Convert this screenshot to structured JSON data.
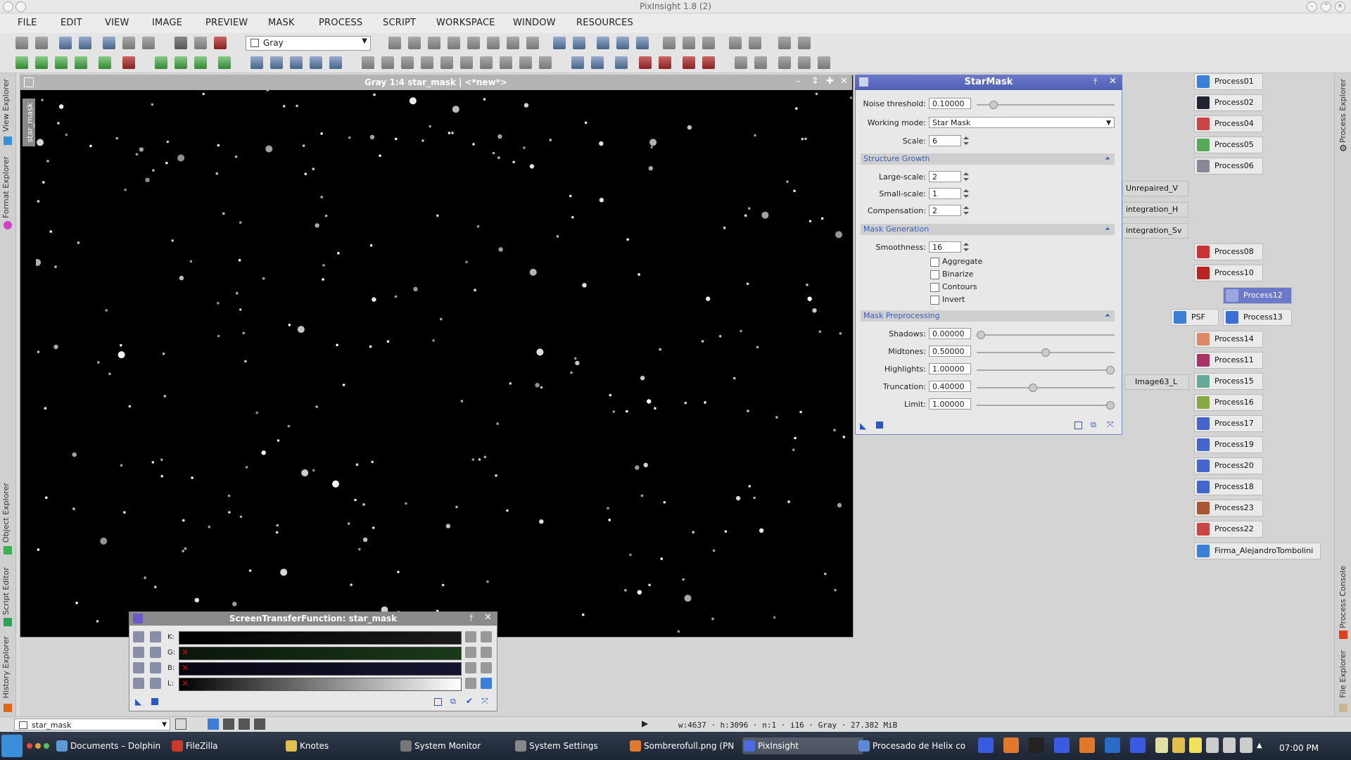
{
  "window": {
    "title": "PixInsight 1.8 (2)"
  },
  "menu": [
    "FILE",
    "EDIT",
    "VIEW",
    "IMAGE",
    "PREVIEW",
    "MASK",
    "PROCESS",
    "SCRIPT",
    "WORKSPACE",
    "WINDOW",
    "RESOURCES"
  ],
  "toolbar": {
    "view_mode": "Gray"
  },
  "sidebar_left": [
    "View Explorer",
    "Format Explorer",
    "Object Explorer",
    "Script Editor",
    "History Explorer"
  ],
  "sidebar_right": [
    "Process Explorer",
    "Process Console",
    "File Explorer"
  ],
  "image_window": {
    "title": "Gray 1:4 star_mask | <*new*>",
    "tab": "star_mask"
  },
  "starmask": {
    "title": "StarMask",
    "noise_threshold": {
      "label": "Noise threshold:",
      "value": "0.10000",
      "level": 0.1
    },
    "working_mode": {
      "label": "Working mode:",
      "value": "Star Mask"
    },
    "scale": {
      "label": "Scale:",
      "value": "6"
    },
    "structure_growth": {
      "title": "Structure Growth",
      "large_scale": {
        "label": "Large-scale:",
        "value": "2"
      },
      "small_scale": {
        "label": "Small-scale:",
        "value": "1"
      },
      "compensation": {
        "label": "Compensation:",
        "value": "2"
      }
    },
    "mask_generation": {
      "title": "Mask Generation",
      "smoothness": {
        "label": "Smoothness:",
        "value": "16"
      },
      "aggregate": "Aggregate",
      "binarize": "Binarize",
      "contours": "Contours",
      "invert": "Invert"
    },
    "mask_preprocessing": {
      "title": "Mask Preprocessing",
      "shadows": {
        "label": "Shadows:",
        "value": "0.00000",
        "level": 0.0
      },
      "midtones": {
        "label": "Midtones:",
        "value": "0.50000",
        "level": 0.5
      },
      "highlights": {
        "label": "Highlights:",
        "value": "1.00000",
        "level": 1.0
      },
      "truncation": {
        "label": "Truncation:",
        "value": "0.40000",
        "level": 0.4
      },
      "limit": {
        "label": "Limit:",
        "value": "1.00000",
        "level": 1.0
      }
    }
  },
  "process_icons": [
    "Process01",
    "Process02",
    "Process04",
    "Process05",
    "Process06",
    "Process08",
    "Process10",
    "Process12",
    "PSF",
    "Process13",
    "Process14",
    "Process11",
    "Process15",
    "Process16",
    "Process17",
    "Process19",
    "Process20",
    "Process18",
    "Process23",
    "Process22",
    "Firma_AlejandroTombolini"
  ],
  "image_icons": [
    "Unrepaired_V",
    "integration_H",
    "integration_Sv",
    "Image63_L"
  ],
  "stf": {
    "title": "ScreenTransferFunction: star_mask",
    "channels": [
      "K:",
      "G:",
      "B:",
      "L:"
    ]
  },
  "status": {
    "view": "star_mask",
    "info": "w:4637 · h:3096 · n:1 · i16 · Gray · 27.382 MiB"
  },
  "taskbar": {
    "tasks": [
      "Documents – Dolphin",
      "FileZilla",
      "Knotes",
      "System Monitor",
      "System Settings",
      "Sombrerofull.png (PN",
      "PixInsight",
      "Procesado de Helix co"
    ],
    "clock": "07:00 PM"
  }
}
